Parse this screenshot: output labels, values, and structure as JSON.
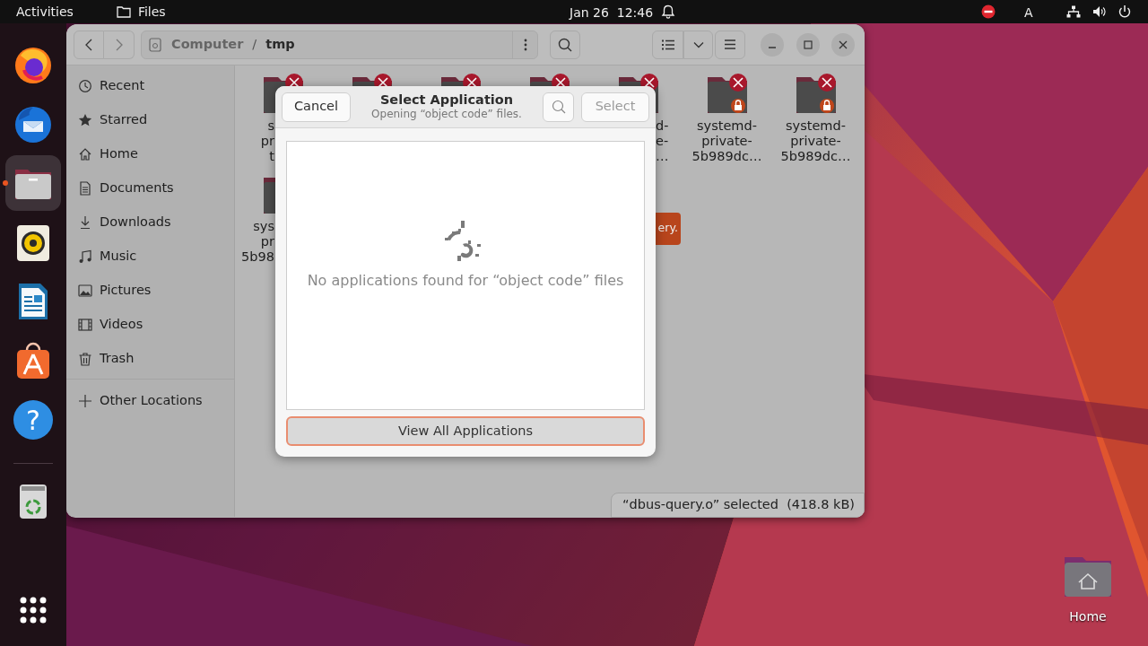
{
  "top_bar": {
    "activities": "Activities",
    "app": "Files",
    "clock": "Jan 26  12:46",
    "keyboard": "A"
  },
  "dock": [
    {
      "kind": "firefox",
      "running": false
    },
    {
      "kind": "thunderbird",
      "running": false
    },
    {
      "kind": "files",
      "running": true
    },
    {
      "kind": "rhythmbox",
      "running": false
    },
    {
      "kind": "writer",
      "running": false
    },
    {
      "kind": "appcenter",
      "running": false
    },
    {
      "kind": "help",
      "running": false,
      "glyph": "?"
    },
    {
      "kind": "trash",
      "running": false
    }
  ],
  "window": {
    "path": [
      "Computer",
      "tmp"
    ],
    "sidebar": [
      {
        "kind": "recent",
        "label": "Recent"
      },
      {
        "kind": "starred",
        "label": "Starred"
      },
      {
        "kind": "home",
        "label": "Home"
      },
      {
        "kind": "documents",
        "label": "Documents"
      },
      {
        "kind": "downloads",
        "label": "Downloads"
      },
      {
        "kind": "music",
        "label": "Music"
      },
      {
        "kind": "pictures",
        "label": "Pictures"
      },
      {
        "kind": "videos",
        "label": "Videos"
      },
      {
        "kind": "trash",
        "label": "Trash"
      },
      {
        "kind": "other",
        "label": "Other Locations"
      }
    ],
    "path_separator": "/",
    "files": [
      {
        "label_lines": [
          "s",
          "pr",
          "t"
        ],
        "unreadable": true
      },
      {
        "unreadable": true
      },
      {
        "unreadable": true
      },
      {
        "unreadable": true
      },
      {
        "label_lines": [
          "d-",
          "e-",
          "…"
        ],
        "unreadable": true
      },
      {
        "label_lines": [
          "systemd-",
          "private-",
          "5b989dc…"
        ],
        "unreadable": true,
        "locked": true
      },
      {
        "label_lines": [
          "systemd-",
          "private-",
          "5b989dc…"
        ],
        "unreadable": true,
        "locked": true
      },
      {
        "label_lines": [
          "sys",
          "pr",
          "5b98"
        ]
      }
    ],
    "toast": "ery.",
    "status": "“dbus-query.o” selected  (418.8 kB)"
  },
  "dialog": {
    "cancel": "Cancel",
    "title": "Select Application",
    "subtitle": "Opening “object code” files.",
    "select": {
      "label": "Select",
      "disabled": true
    },
    "empty_message": "No applications found for “object code” files",
    "view_all": {
      "label": "View All Applications",
      "focused": true
    }
  },
  "desktop": {
    "icons": [
      {
        "label": "Home"
      }
    ]
  }
}
